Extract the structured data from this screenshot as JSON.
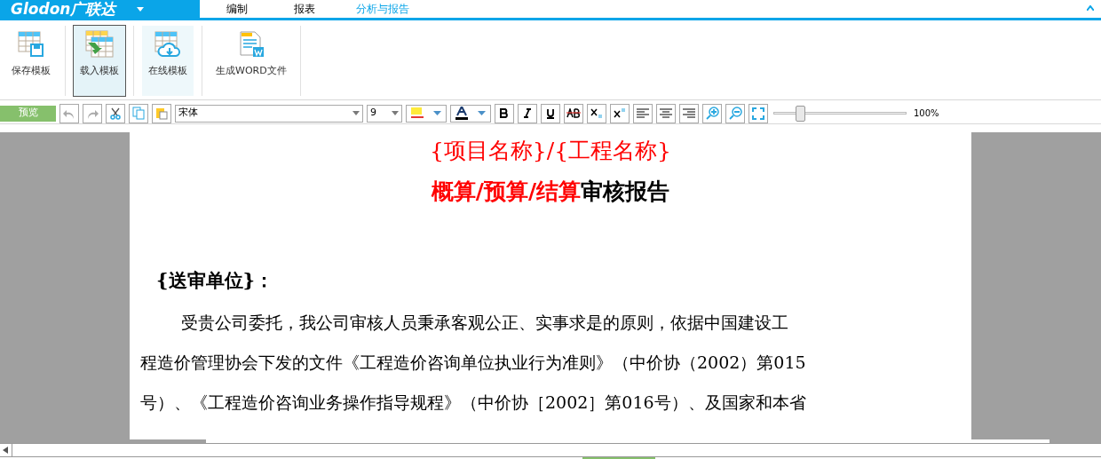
{
  "app": {
    "logo": "Glodon广联达",
    "tabs": [
      {
        "label": "编制",
        "selected": false
      },
      {
        "label": "报表",
        "selected": false
      },
      {
        "label": "分析与报告",
        "selected": true
      }
    ]
  },
  "ribbon": [
    {
      "label": "保存模板",
      "kind": "save",
      "selected": false
    },
    {
      "label": "载入模板",
      "kind": "load",
      "selected": true
    },
    {
      "label": "在线模板",
      "kind": "online",
      "selected": false
    },
    {
      "label": "生成WORD文件",
      "kind": "word",
      "selected": false
    }
  ],
  "toolbar": {
    "preview": "预览",
    "font": "宋体",
    "size": "9",
    "zoom": {
      "level": 0.2,
      "reading": "100%"
    }
  },
  "document": {
    "title": [
      {
        "text": "{项目名称}/{工程名称}",
        "color": "#ff0000"
      }
    ],
    "subtitle": [
      {
        "text": "概算/预算/结算",
        "color": "#ff0000"
      },
      {
        "text": "审核报告",
        "color": "#000000"
      }
    ],
    "heading": "{送审单位}：",
    "lines": [
      "受贵公司委托，我公司审核人员秉承客观公正、实事求是的原则，依据中国建设工",
      "程造价管理协会下发的文件《工程造价咨询单位执业行为准则》（中价协（2002）第015",
      "号）、《工程造价咨询业务操作指导规程》（中价协［2002］第016号）、及国家和本省"
    ]
  }
}
